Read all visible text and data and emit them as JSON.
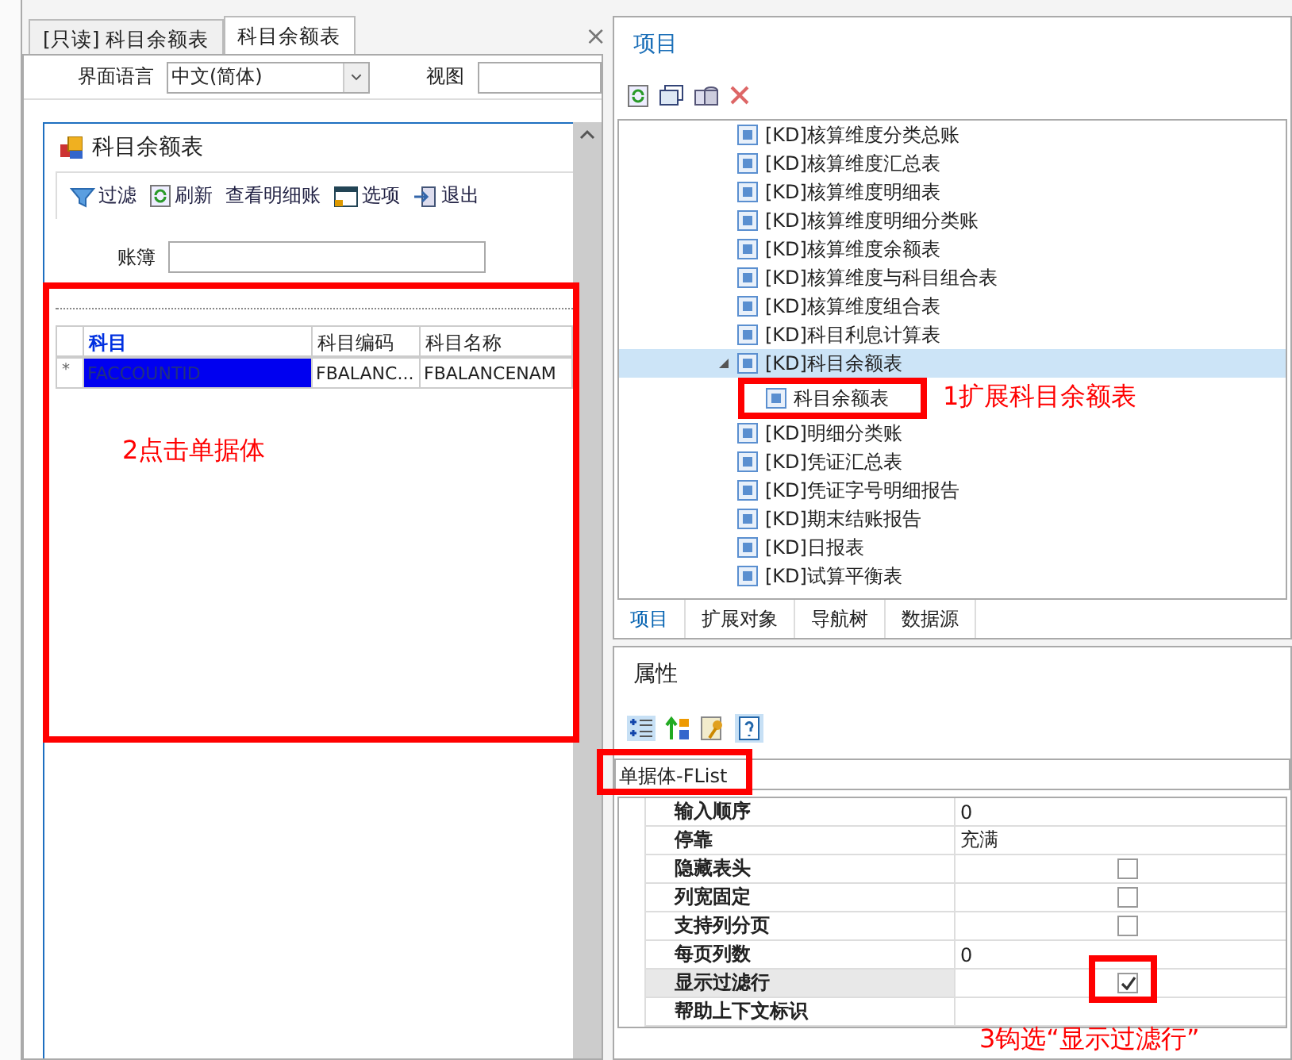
{
  "editor_tabs": [
    {
      "label": "[只读] 科目余额表",
      "selected": false
    },
    {
      "label": "科目余额表",
      "selected": true
    }
  ],
  "editor_close": "×",
  "language_label": "界面语言",
  "language_value": "中文(简体)",
  "view_label": "视图",
  "form": {
    "title": "科目余额表",
    "toolbar": [
      {
        "kind": "filter",
        "label": "过滤"
      },
      {
        "kind": "refresh",
        "label": "刷新"
      },
      {
        "kind": "text",
        "label": "查看明细账"
      },
      {
        "kind": "options",
        "label": "选项"
      },
      {
        "kind": "exit",
        "label": "退出"
      }
    ],
    "book_label": "账簿",
    "grid": {
      "columns": [
        {
          "label": "科目",
          "selected": true
        },
        {
          "label": "科目编码",
          "selected": false
        },
        {
          "label": "科目名称",
          "selected": false
        }
      ],
      "new_row_marker": "*",
      "row": [
        {
          "text": "FACCOUNTID",
          "selected": true
        },
        {
          "text": "FBALANC...",
          "selected": false
        },
        {
          "text": "FBALANCENAM",
          "selected": false
        }
      ]
    }
  },
  "project_panel": {
    "title": "项目",
    "tree": [
      {
        "label": "[KD]核算维度分类总账",
        "selected": false
      },
      {
        "label": "[KD]核算维度汇总表",
        "selected": false
      },
      {
        "label": "[KD]核算维度明细表",
        "selected": false
      },
      {
        "label": "[KD]核算维度明细分类账",
        "selected": false
      },
      {
        "label": "[KD]核算维度余额表",
        "selected": false
      },
      {
        "label": "[KD]核算维度与科目组合表",
        "selected": false
      },
      {
        "label": "[KD]核算维度组合表",
        "selected": false
      },
      {
        "label": "[KD]科目利息计算表",
        "selected": false
      },
      {
        "label": "[KD]科目余额表",
        "expanded": true,
        "selected": true,
        "children": [
          {
            "label": "科目余额表",
            "selected": false
          }
        ]
      },
      {
        "label": "[KD]明细分类账",
        "selected": false
      },
      {
        "label": "[KD]凭证汇总表",
        "selected": false
      },
      {
        "label": "[KD]凭证字号明细报告",
        "selected": false
      },
      {
        "label": "[KD]期末结账报告",
        "selected": false
      },
      {
        "label": "[KD]日报表",
        "selected": false
      },
      {
        "label": "[KD]试算平衡表",
        "selected": false
      }
    ],
    "tabs": [
      {
        "label": "项目",
        "selected": true
      },
      {
        "label": "扩展对象",
        "selected": false
      },
      {
        "label": "导航树",
        "selected": false
      },
      {
        "label": "数据源",
        "selected": false
      }
    ]
  },
  "property_panel": {
    "title": "属性",
    "object": "单据体-FList",
    "rows": [
      {
        "name": "输入顺序",
        "kind": "text",
        "value": "0",
        "selected": false
      },
      {
        "name": "停靠",
        "kind": "text",
        "value": "充满",
        "selected": false
      },
      {
        "name": "隐藏表头",
        "kind": "checkbox",
        "checked": false,
        "selected": false
      },
      {
        "name": "列宽固定",
        "kind": "checkbox",
        "checked": false,
        "selected": false
      },
      {
        "name": "支持列分页",
        "kind": "checkbox",
        "checked": false,
        "selected": false
      },
      {
        "name": "每页列数",
        "kind": "text",
        "value": "0",
        "selected": false
      },
      {
        "name": "显示过滤行",
        "kind": "checkbox",
        "checked": true,
        "selected": true
      },
      {
        "name": "帮助上下文标识",
        "kind": "text",
        "selected": false
      }
    ]
  },
  "annotations": [
    "1扩展科目余额表",
    "2点击单据体",
    "3钩选“显示过滤行”"
  ]
}
